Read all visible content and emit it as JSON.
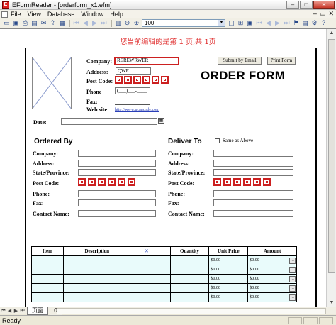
{
  "window": {
    "title": "EFormReader - [orderform_x1.efm]"
  },
  "menu": {
    "items": [
      "File",
      "View",
      "Database",
      "Window",
      "Help"
    ]
  },
  "toolbar": {
    "zoom_value": "100"
  },
  "page_indicator": "您当前编辑的是第 1 页,共 1页",
  "form": {
    "title": "ORDER FORM",
    "company_label": "Company:",
    "company_value": "REREWRWER",
    "address_label": "Address:",
    "address_value": "QWE",
    "postcode_label": "Post Code:",
    "phone_label": "Phone",
    "phone_mask": "(___)___-____",
    "fax_label": "Fax:",
    "website_label": "Web site:",
    "website_value": "http://www.ucancode.com",
    "submit_email_label": "Submit by Email",
    "print_form_label": "Print Form",
    "date_label": "Date:"
  },
  "ordered_by": {
    "title": "Ordered By",
    "company_label": "Company:",
    "address_label": "Address:",
    "state_label": "State/Province:",
    "postcode_label": "Post Code:",
    "phone_label": "Phone:",
    "fax_label": "Fax:",
    "contact_label": "Contact Name:"
  },
  "deliver_to": {
    "title": "Deliver To",
    "same_as_above_label": "Same as Above",
    "company_label": "Company:",
    "address_label": "Address:",
    "state_label": "State/Province:",
    "postcode_label": "Post Code:",
    "phone_label": "Phone:",
    "fax_label": "Fax:",
    "contact_label": "Contact Name:"
  },
  "items_table": {
    "columns": [
      "Item",
      "Description",
      "Quantity",
      "Unit Price",
      "Amount"
    ],
    "rows": [
      {
        "unit_price": "$0.00",
        "amount": "$0.00"
      },
      {
        "unit_price": "$0.00",
        "amount": "$0.00"
      },
      {
        "unit_price": "$0.00",
        "amount": "$0.00"
      },
      {
        "unit_price": "$0.00",
        "amount": "$0.00"
      },
      {
        "unit_price": "$0.00",
        "amount": "$0.00"
      }
    ]
  },
  "tabs": {
    "tab1": "页面",
    "tab2": "0"
  },
  "status": {
    "text": "Ready"
  },
  "colors": {
    "highlight_red": "#cc2020",
    "page_label_red": "#e03030",
    "link_blue": "#2a3fb8"
  }
}
